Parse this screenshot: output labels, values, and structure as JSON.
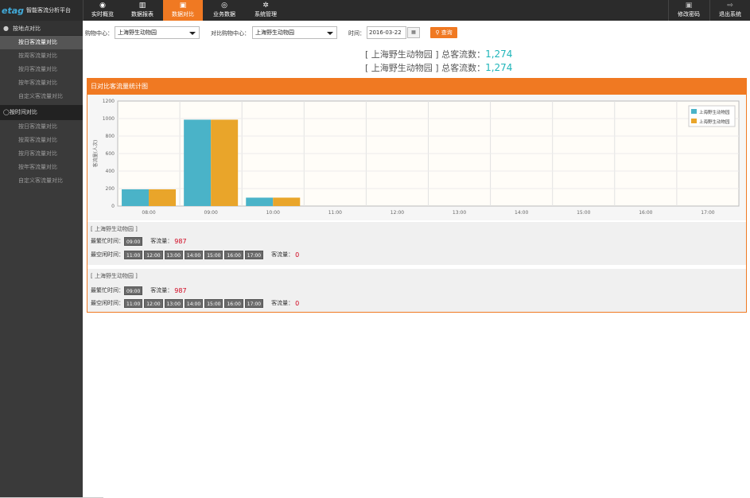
{
  "app": {
    "logo": "etag",
    "title": "智能客流分析平台"
  },
  "nav": [
    {
      "label": "实时概览",
      "icon": "eye-icon",
      "glyph": "◉"
    },
    {
      "label": "数据报表",
      "icon": "bar-chart-icon",
      "glyph": "▥"
    },
    {
      "label": "数据对比",
      "icon": "image-icon",
      "glyph": "▣"
    },
    {
      "label": "业务数据",
      "icon": "compass-icon",
      "glyph": "◎"
    },
    {
      "label": "系统管理",
      "icon": "gear-icon",
      "glyph": "✲"
    }
  ],
  "topright": [
    {
      "label": "修改密码",
      "icon": "lock-icon",
      "glyph": "🔒"
    },
    {
      "label": "退出系统",
      "icon": "logout-icon",
      "glyph": "⎋"
    }
  ],
  "sidebar": {
    "group1": "按地点对比",
    "group1_items": [
      "按日客流量对比",
      "按周客流量对比",
      "按月客流量对比",
      "按年客流量对比",
      "自定义客流量对比"
    ],
    "group2": "按时间对比",
    "group2_items": [
      "按日客流量对比",
      "按周客流量对比",
      "按月客流量对比",
      "按年客流量对比",
      "自定义客流量对比"
    ]
  },
  "filters": {
    "center_label": "购物中心：",
    "center_value": "上海野生动物园",
    "compare_label": "对比购物中心：",
    "compare_value": "上海野生动物园",
    "time_label": "时间：",
    "date_value": "2016-03-22",
    "search_label": "查询"
  },
  "totals": [
    {
      "name": "[ 上海野生动物园 ] 总客流数：",
      "value": "1,274"
    },
    {
      "name": "[ 上海野生动物园 ] 总客流数：",
      "value": "1,274"
    }
  ],
  "panel_title": "日对比客流量统计图",
  "colors": {
    "accent": "#f07922",
    "series1": "#4ab3c8",
    "series2": "#e9a52a",
    "total_num": "#1fb5ba"
  },
  "chart_data": {
    "type": "bar",
    "categories": [
      "08:00",
      "09:00",
      "10:00",
      "11:00",
      "12:00",
      "13:00",
      "14:00",
      "15:00",
      "16:00",
      "17:00"
    ],
    "series": [
      {
        "name": "上海野生动物园",
        "values": [
          191,
          987,
          96,
          0,
          0,
          0,
          0,
          0,
          0,
          0
        ]
      },
      {
        "name": "上海野生动物园",
        "values": [
          191,
          987,
          96,
          0,
          0,
          0,
          0,
          0,
          0,
          0
        ]
      }
    ],
    "ylabel": "客流量(人次)",
    "ylim": [
      0,
      1200
    ],
    "yticks": [
      0,
      200,
      400,
      600,
      800,
      1000,
      1200
    ],
    "grid": true,
    "legend": "top-right"
  },
  "sections": [
    {
      "title": "[ 上海野生动物园 ]",
      "busy_label": "最繁忙时间：",
      "busy_times": [
        "09:00"
      ],
      "busy_flow_label": "客流量：",
      "busy_flow": "987",
      "idle_label": "最空闲时间：",
      "idle_times": [
        "11:00",
        "12:00",
        "13:00",
        "14:00",
        "15:00",
        "16:00",
        "17:00"
      ],
      "idle_flow_label": "客流量：",
      "idle_flow": "0"
    },
    {
      "title": "[ 上海野生动物园 ]",
      "busy_label": "最繁忙时间：",
      "busy_times": [
        "09:00"
      ],
      "busy_flow_label": "客流量：",
      "busy_flow": "987",
      "idle_label": "最空闲时间：",
      "idle_times": [
        "11:00",
        "12:00",
        "13:00",
        "14:00",
        "15:00",
        "16:00",
        "17:00"
      ],
      "idle_flow_label": "客流量：",
      "idle_flow": "0"
    }
  ]
}
